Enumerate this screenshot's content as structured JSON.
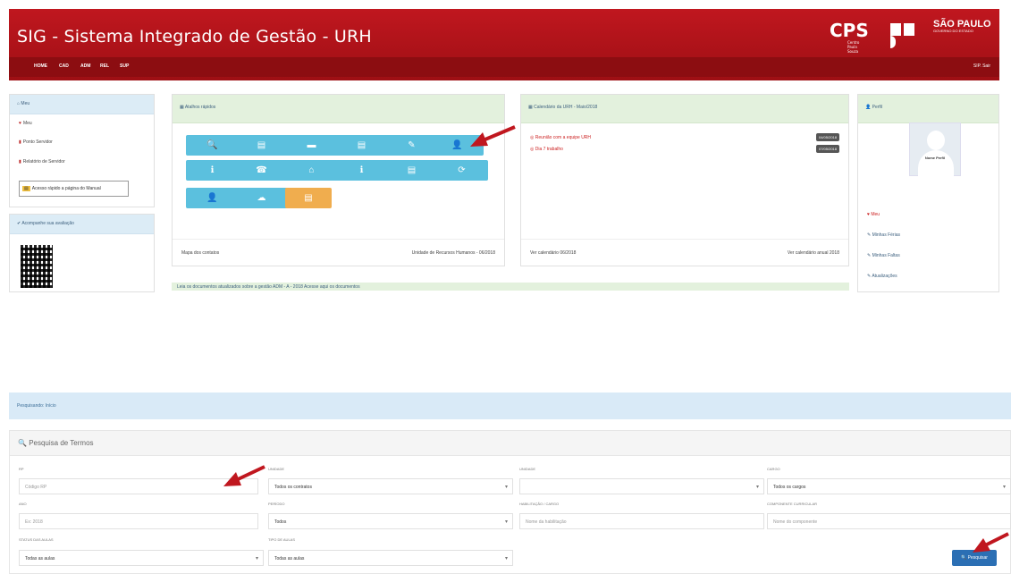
{
  "header": {
    "title": "SIG - Sistema Integrado de Gestão - URH",
    "logo_cps": "CPS",
    "logo_cps_sub": "Centro Paula Souza",
    "logo_sp": "SÃO PAULO",
    "logo_sp_sub": "GOVERNO DO ESTADO",
    "menu": [
      "HOME",
      "CAD",
      "ADM",
      "REL",
      "SUP"
    ],
    "user_label": "SIP. Sair"
  },
  "left_panel": {
    "title": "Meu",
    "links": [
      "Meu",
      "Ponto Servidor",
      "Relatório de Servidor"
    ],
    "alert": "Acesso rápido a página do Manual"
  },
  "left_panel2": {
    "title": "Acompanhe sua avaliação"
  },
  "shortcuts": {
    "title": "Atalhos rápidos",
    "tiles": [
      "🔍",
      "▤",
      "▬",
      "▤",
      "✎",
      "👤",
      "ℹ",
      "☎",
      "⌂",
      "ℹ",
      "▤",
      "⟳",
      "👤",
      "☁",
      "▤"
    ],
    "footer_left": "Mapa dos contatos",
    "footer_right": "Unidade de Recursos Humanos - 06/2018"
  },
  "calendar": {
    "title": "Calendário da URH - Maio/2018",
    "events": [
      {
        "label": "Reunião com a equipe URH",
        "date": "04/05/2018"
      },
      {
        "label": "Dia 7 trabalho",
        "date": "07/05/2018"
      }
    ],
    "footer_left": "Ver calendário 06/2018",
    "footer_right": "Ver calendário anual 2018"
  },
  "profile": {
    "title": "Perfil",
    "avatar_caption": "Nome Perfil",
    "links": [
      "Meu",
      "Minhas Férias",
      "Minhas Faltas",
      "Atualizações"
    ]
  },
  "notice": "Leia os documentos atualizados sobre a gestão ADM - A - 2018 Acesse aqui os documentos",
  "breadcrumb": "Pesquisando: Início",
  "search": {
    "title": "Pesquisa de Termos",
    "fields": {
      "rp": {
        "label": "RP",
        "placeholder": "Código RP"
      },
      "unidade": {
        "label": "Unidade",
        "value": "Todos os contratos"
      },
      "unidade2": {
        "label": "Unidade",
        "value": ""
      },
      "cargo": {
        "label": "Cargo",
        "value": "Todos os cargos"
      },
      "ano": {
        "label": "Ano",
        "placeholder": "Ex: 2018"
      },
      "periodo": {
        "label": "Período",
        "value": "Todos"
      },
      "habilitacao": {
        "label": "Habilitação / Cargo",
        "placeholder": "Nome da habilitação"
      },
      "componente": {
        "label": "Componente Curricular",
        "placeholder": "Nome do componente"
      },
      "status": {
        "label": "Status das aulas",
        "value": "Todas as aulas"
      },
      "tipo": {
        "label": "Tipo de aulas",
        "value": "Todas as aulas"
      }
    },
    "button_label": "🔍 Pesquisar"
  },
  "colors": {
    "brand_red": "#b5141b",
    "tile_blue": "#5bc0de",
    "tile_orange": "#f0ad4e",
    "panel_green": "#e3f1dd",
    "button_blue": "#2b6fb4",
    "arrow": "#c0171f"
  }
}
